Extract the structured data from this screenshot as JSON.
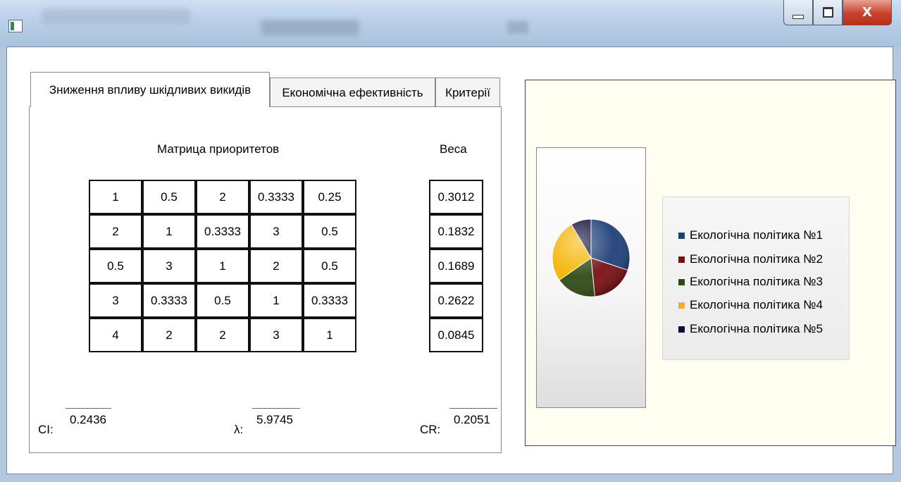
{
  "tabs": [
    {
      "label": "Зниження впливу шкідливих викидів",
      "active": true
    },
    {
      "label": "Економічна ефективність",
      "active": false
    },
    {
      "label": "Критерії",
      "active": false
    }
  ],
  "matrix": {
    "title": "Матрица приоритетов",
    "rows": [
      [
        "1",
        "0.5",
        "2",
        "0.3333",
        "0.25"
      ],
      [
        "2",
        "1",
        "0.3333",
        "3",
        "0.5"
      ],
      [
        "0.5",
        "3",
        "1",
        "2",
        "0.5"
      ],
      [
        "3",
        "0.3333",
        "0.5",
        "1",
        "0.3333"
      ],
      [
        "4",
        "2",
        "2",
        "3",
        "1"
      ]
    ]
  },
  "weights": {
    "title": "Веса",
    "values": [
      "0.3012",
      "0.1832",
      "0.1689",
      "0.2622",
      "0.0845"
    ]
  },
  "stats": {
    "ci_label": "CI:",
    "ci_value": "0.2436",
    "lambda_label": "λ:",
    "lambda_value": "5.9745",
    "cr_label": "CR:",
    "cr_value": "0.2051"
  },
  "window_controls": {
    "close_label": "X"
  },
  "chart_data": {
    "type": "pie",
    "series": [
      {
        "name": "Екологічна політика №1",
        "value": 0.3012,
        "color": "#1e3f78"
      },
      {
        "name": "Екологічна політика №2",
        "value": 0.1832,
        "color": "#7a0f14"
      },
      {
        "name": "Екологічна політика №3",
        "value": 0.1689,
        "color": "#2d4a14"
      },
      {
        "name": "Екологічна політика №4",
        "value": 0.2622,
        "color": "#f4b400"
      },
      {
        "name": "Екологічна політика №5",
        "value": 0.0845,
        "color": "#0c0c3a"
      }
    ],
    "legend_position": "right"
  }
}
